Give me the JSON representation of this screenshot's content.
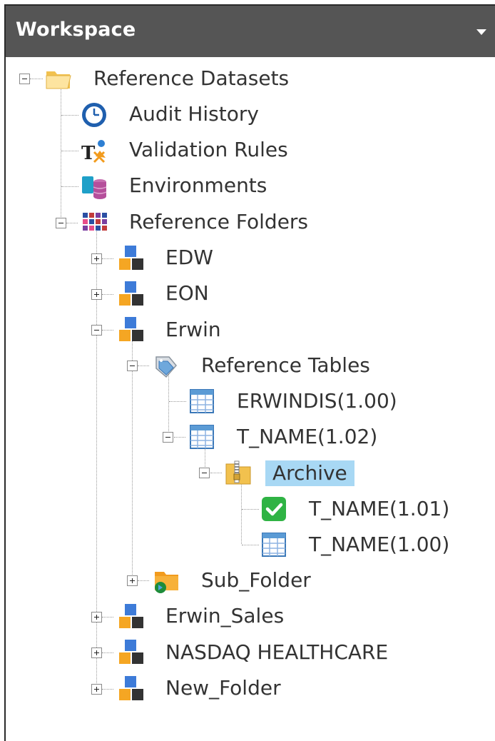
{
  "panel": {
    "title": "Workspace",
    "colors": {
      "header_bg": "#555555",
      "header_text": "#ffffff",
      "selection": "#a8d8f4"
    }
  },
  "tree": {
    "root": {
      "label": "Reference Datasets",
      "icon": "folder-open-icon",
      "expanded": true
    },
    "audit_history": {
      "label": "Audit History",
      "icon": "clock-icon"
    },
    "validation_rules": {
      "label": "Validation Rules",
      "icon": "validation-rules-icon"
    },
    "environments": {
      "label": "Environments",
      "icon": "environments-icon"
    },
    "reference_folders": {
      "label": "Reference Folders",
      "icon": "grid-icon",
      "expanded": true
    },
    "edw": {
      "label": "EDW",
      "icon": "folder-blocks-icon",
      "expanded": false
    },
    "eon": {
      "label": "EON",
      "icon": "folder-blocks-icon",
      "expanded": false
    },
    "erwin": {
      "label": "Erwin",
      "icon": "folder-blocks-icon",
      "expanded": true
    },
    "reference_tables": {
      "label": "Reference Tables",
      "icon": "tags-icon",
      "expanded": true
    },
    "erwindis": {
      "label": "ERWINDIS(1.00)",
      "icon": "table-icon"
    },
    "t_name_102": {
      "label": "T_NAME(1.02)",
      "icon": "table-icon",
      "expanded": true
    },
    "archive": {
      "label": "Archive",
      "icon": "archive-folder-icon",
      "expanded": true,
      "selected": true
    },
    "t_name_101": {
      "label": "T_NAME(1.01)",
      "icon": "check-icon"
    },
    "t_name_100": {
      "label": "T_NAME(1.00)",
      "icon": "table-icon"
    },
    "sub_folder": {
      "label": "Sub_Folder",
      "icon": "sub-folder-icon",
      "expanded": false
    },
    "erwin_sales": {
      "label": "Erwin_Sales",
      "icon": "folder-blocks-icon",
      "expanded": false
    },
    "nasdaq": {
      "label": "NASDAQ HEALTHCARE",
      "icon": "folder-blocks-icon",
      "expanded": false
    },
    "new_folder": {
      "label": "New_Folder",
      "icon": "folder-blocks-icon",
      "expanded": false
    }
  }
}
